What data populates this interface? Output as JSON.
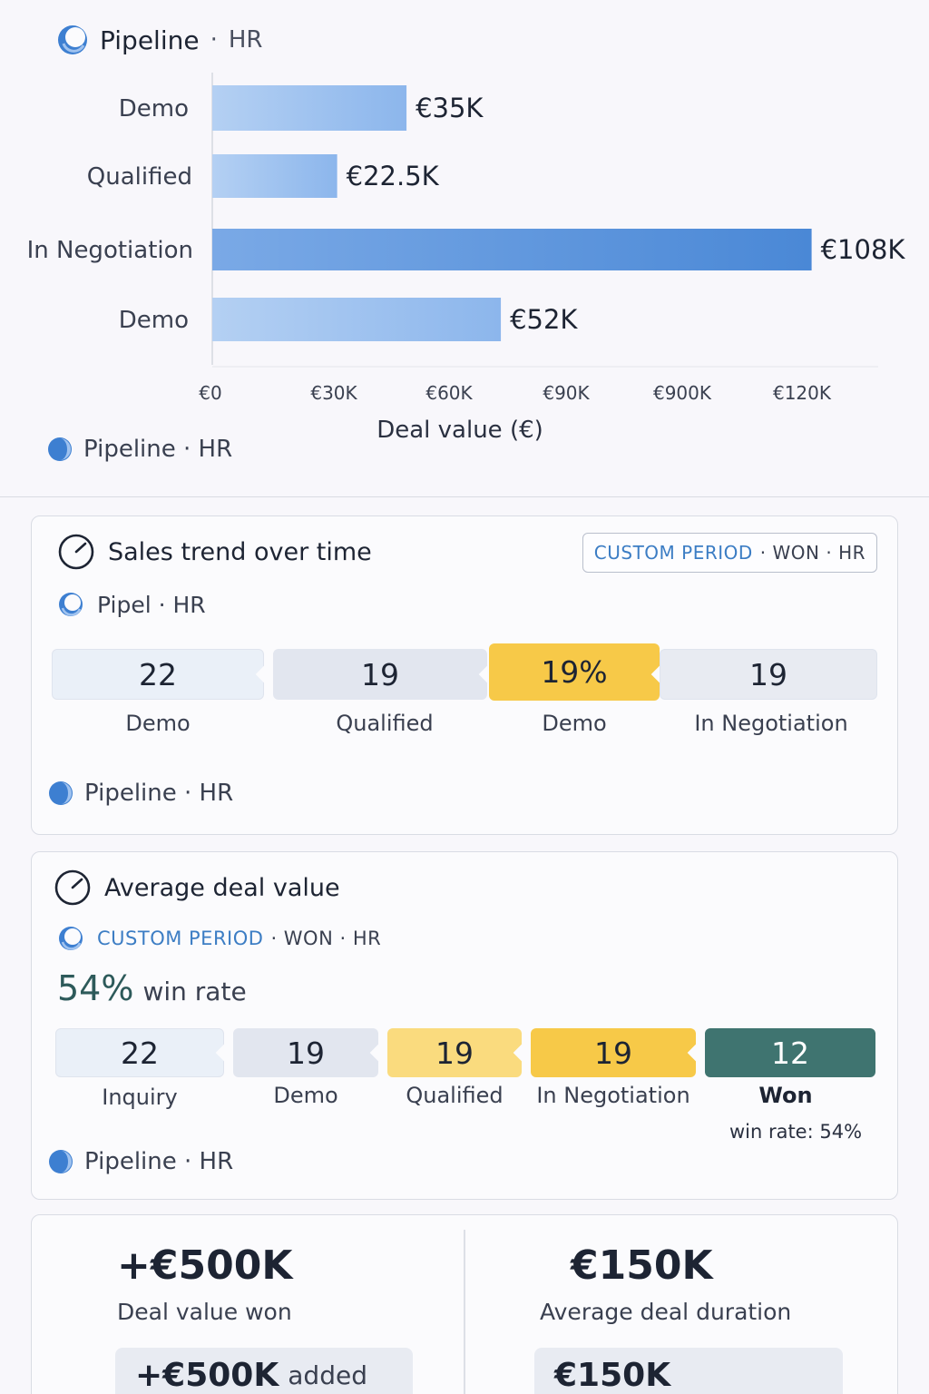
{
  "header": {
    "title": "Pipeline",
    "separator": "·",
    "team": "HR"
  },
  "chart_data": {
    "type": "bar",
    "orientation": "horizontal",
    "categories": [
      "Demo",
      "Qualified",
      "In Negotiation",
      "Demo"
    ],
    "values": [
      35000,
      22500,
      108000,
      52000
    ],
    "value_labels": [
      "€35K",
      "€22.5K",
      "€108K",
      "€52K"
    ],
    "x_ticks": [
      "€0",
      "€30K",
      "€60K",
      "€90K",
      "€900K",
      "€120K"
    ],
    "xlabel": "Deal value (€)",
    "xlim": [
      0,
      120000
    ],
    "grid": false,
    "colors": [
      "#9fc2ef",
      "#9fc2ef",
      "#4f8fdc",
      "#9fc2ef"
    ]
  },
  "top_footer": "Pipeline · HR",
  "trend_card": {
    "title": "Sales trend over time",
    "chip": {
      "accent": "CUSTOM PERIOD",
      "rest": "· WON · HR"
    },
    "subtitle": "Pipel · HR",
    "stages": [
      {
        "value": "22",
        "label": "Demo",
        "color": "#eaf0f8"
      },
      {
        "value": "19",
        "label": "Qualified",
        "color": "#e2e6ef"
      },
      {
        "value": "19%",
        "label": "Demo",
        "color": "#f7c948"
      },
      {
        "value": "19",
        "label": "In Negotiation",
        "color": "#e8ebf2"
      }
    ],
    "footer": "Pipeline · HR"
  },
  "avg_card": {
    "title": "Average deal value",
    "sub_accent": "CUSTOM PERIOD",
    "sub_rest": "· WON · HR",
    "win_rate_value": "54%",
    "win_rate_label": "win rate",
    "stages": [
      {
        "value": "22",
        "label": "Inquiry",
        "color": "#eaf0f8"
      },
      {
        "value": "19",
        "label": "Demo",
        "color": "#e2e6ef"
      },
      {
        "value": "19",
        "label": "Qualified",
        "color": "#fadb7e"
      },
      {
        "value": "19",
        "label": "In Negotiation",
        "color": "#f7c948"
      },
      {
        "value": "12",
        "label": "Won",
        "color": "#3f7470"
      }
    ],
    "won_note": "win rate: 54%",
    "footer": "Pipeline · HR"
  },
  "kpi_card": {
    "left": {
      "value": "+€500K",
      "label": "Deal value won",
      "pill_value": "+€500K",
      "pill_label": "added"
    },
    "right": {
      "value": "€150K",
      "label": "Average deal duration",
      "pill_value": "€150K"
    }
  }
}
